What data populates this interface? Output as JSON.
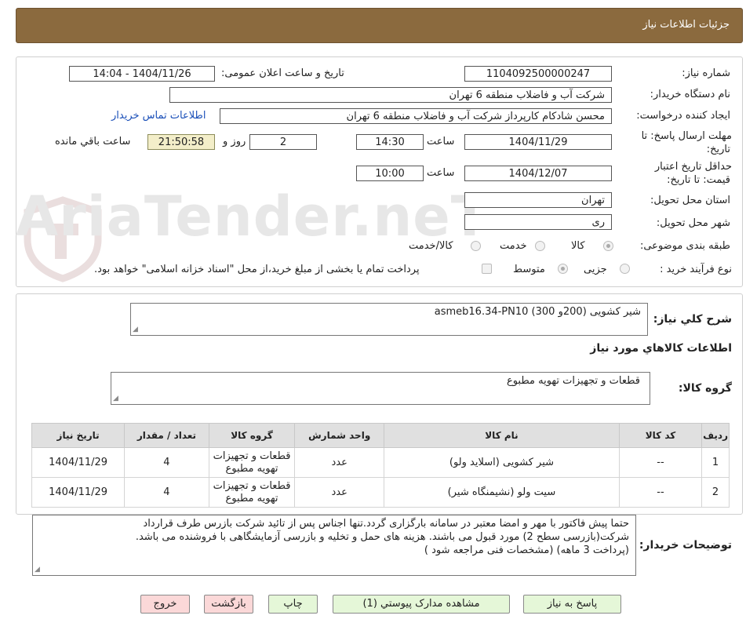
{
  "header": {
    "title": "جزئیات اطلاعات نیاز"
  },
  "watermark": {
    "text": "AriaTender.neT"
  },
  "form": {
    "need_number_label": "شماره نیاز:",
    "need_number": "1104092500000247",
    "announce_label": "تاریخ و ساعت اعلان عمومی:",
    "announce_value": "1404/11/26 - 14:04",
    "buyer_org_label": "نام دستگاه خریدار:",
    "buyer_org": "شرکت آب و فاضلاب منطقه 6 تهران",
    "creator_label": "ایجاد کننده درخواست:",
    "creator": "محسن شادکام کارپرداز شرکت آب و فاضلاب منطقه 6 تهران",
    "contact_link": "اطلاعات تماس خریدار",
    "deadline_label_1": "مهلت ارسال پاسخ: تا",
    "deadline_label_2": "تاریخ:",
    "deadline_date": "1404/11/29",
    "time_label": "ساعت",
    "deadline_time": "14:30",
    "days_value": "2",
    "days_label": "روز و",
    "timer_value": "21:50:58",
    "remaining_label": "ساعت باقي مانده",
    "validity_label_1": "حداقل تاریخ اعتبار",
    "validity_label_2": "قیمت: تا تاریخ:",
    "validity_date": "1404/12/07",
    "validity_time": "10:00",
    "province_label": "استان محل تحویل:",
    "province": "تهران",
    "city_label": "شهر محل تحویل:",
    "city": "ری",
    "category_label": "طبقه بندی موضوعی:",
    "category_options": [
      "کالا",
      "خدمت",
      "کالا/خدمت"
    ],
    "process_label": "نوع فرآیند خرید :",
    "process_options": [
      "جزیی",
      "متوسط"
    ],
    "payment_note": "پرداخت تمام یا بخشی از مبلغ خرید،از محل \"اسناد خزانه اسلامی\" خواهد بود."
  },
  "summary": {
    "label": "شرح کلي نیاز:",
    "value": "شیر کشویی (200و 300) asmeb16.34-PN10",
    "goods_title": "اطلاعات کالاهاي مورد نياز",
    "group_label": "گروه کالا:",
    "group_value": "قطعات و تجهیزات تهویه مطبوع"
  },
  "table": {
    "headers": [
      "ردیف",
      "کد کالا",
      "نام کالا",
      "واحد شمارش",
      "گروه کالا",
      "تعداد / مقدار",
      "تاریخ نیاز"
    ],
    "rows": [
      {
        "idx": "1",
        "code": "--",
        "name": "شیر کشویی (اسلاید ولو)",
        "unit": "عدد",
        "group": "قطعات و تجهیزات تهویه مطبوع",
        "qty": "4",
        "date": "1404/11/29"
      },
      {
        "idx": "2",
        "code": "--",
        "name": "سیت ولو (نشیمنگاه شیر)",
        "unit": "عدد",
        "group": "قطعات و تجهیزات تهویه مطبوع",
        "qty": "4",
        "date": "1404/11/29"
      }
    ]
  },
  "notes": {
    "label": "توضیحات خریدار:",
    "lines": [
      "حتما پیش فاکتور با مهر و امضا معتبر در سامانه بارگزاری گردد.تنها اجناس پس از تائید شرکت بازرس طرف قرارداد",
      "شرکت(بازرسی سطح 2) مورد قبول می باشند. هزینه های حمل و تخلیه و بازرسی آزمایشگاهی با فروشنده می باشد.",
      "(پرداخت 3 ماهه) (مشخصات فنی مراجعه شود )"
    ]
  },
  "buttons": {
    "reply": "پاسخ به نیاز",
    "attachments": "مشاهده مدارک پیوستي (1)",
    "print": "چاپ",
    "back": "بازگشت",
    "exit": "خروج"
  }
}
